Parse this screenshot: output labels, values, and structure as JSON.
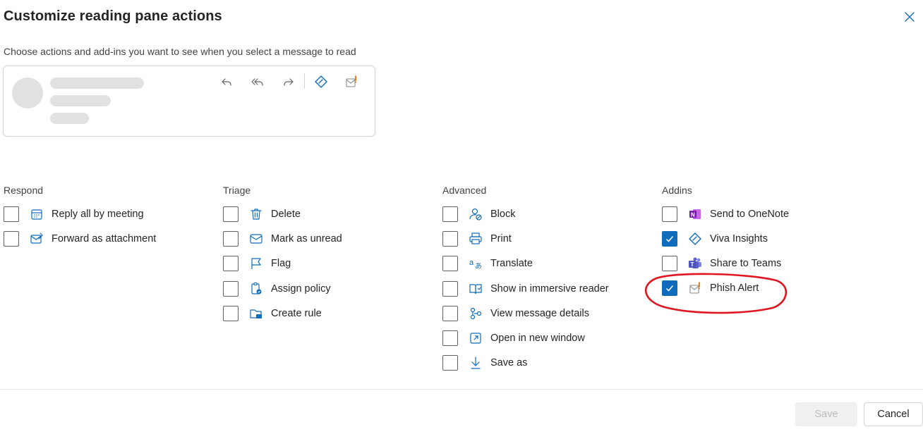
{
  "dialog": {
    "title": "Customize reading pane actions",
    "subtitle": "Choose actions and add-ins you want to see when you select a message to read"
  },
  "preview": {
    "icons": [
      "reply-icon",
      "reply-all-icon",
      "forward-icon",
      "viva-insights-icon",
      "phish-alert-icon"
    ]
  },
  "columns": {
    "respond": {
      "title": "Respond",
      "items": [
        {
          "label": "Reply all by meeting",
          "checked": false,
          "icon": "calendar-icon"
        },
        {
          "label": "Forward as attachment",
          "checked": false,
          "icon": "mail-attachment-icon"
        }
      ]
    },
    "triage": {
      "title": "Triage",
      "items": [
        {
          "label": "Delete",
          "checked": false,
          "icon": "trash-icon"
        },
        {
          "label": "Mark as unread",
          "checked": false,
          "icon": "mail-icon"
        },
        {
          "label": "Flag",
          "checked": false,
          "icon": "flag-icon"
        },
        {
          "label": "Assign policy",
          "checked": false,
          "icon": "policy-icon"
        },
        {
          "label": "Create rule",
          "checked": false,
          "icon": "folder-rule-icon"
        }
      ]
    },
    "advanced": {
      "title": "Advanced",
      "items": [
        {
          "label": "Block",
          "checked": false,
          "icon": "block-icon"
        },
        {
          "label": "Print",
          "checked": false,
          "icon": "printer-icon"
        },
        {
          "label": "Translate",
          "checked": false,
          "icon": "translate-icon"
        },
        {
          "label": "Show in immersive reader",
          "checked": false,
          "icon": "immersive-reader-icon"
        },
        {
          "label": "View message details",
          "checked": false,
          "icon": "message-details-icon"
        },
        {
          "label": "Open in new window",
          "checked": false,
          "icon": "open-window-icon"
        },
        {
          "label": "Save as",
          "checked": false,
          "icon": "download-icon"
        }
      ]
    },
    "addins": {
      "title": "Addins",
      "items": [
        {
          "label": "Send to OneNote",
          "checked": false,
          "icon": "onenote-icon"
        },
        {
          "label": "Viva Insights",
          "checked": true,
          "icon": "viva-insights-icon"
        },
        {
          "label": "Share to Teams",
          "checked": false,
          "icon": "teams-icon"
        },
        {
          "label": "Phish Alert",
          "checked": true,
          "icon": "phish-alert-icon"
        }
      ]
    }
  },
  "footer": {
    "save_label": "Save",
    "cancel_label": "Cancel"
  },
  "colors": {
    "accent": "#0f6cbd",
    "annotation": "#e0161e",
    "onenote": "#7719aa",
    "teams": "#5b5fc7",
    "phish": "#e8730c"
  }
}
